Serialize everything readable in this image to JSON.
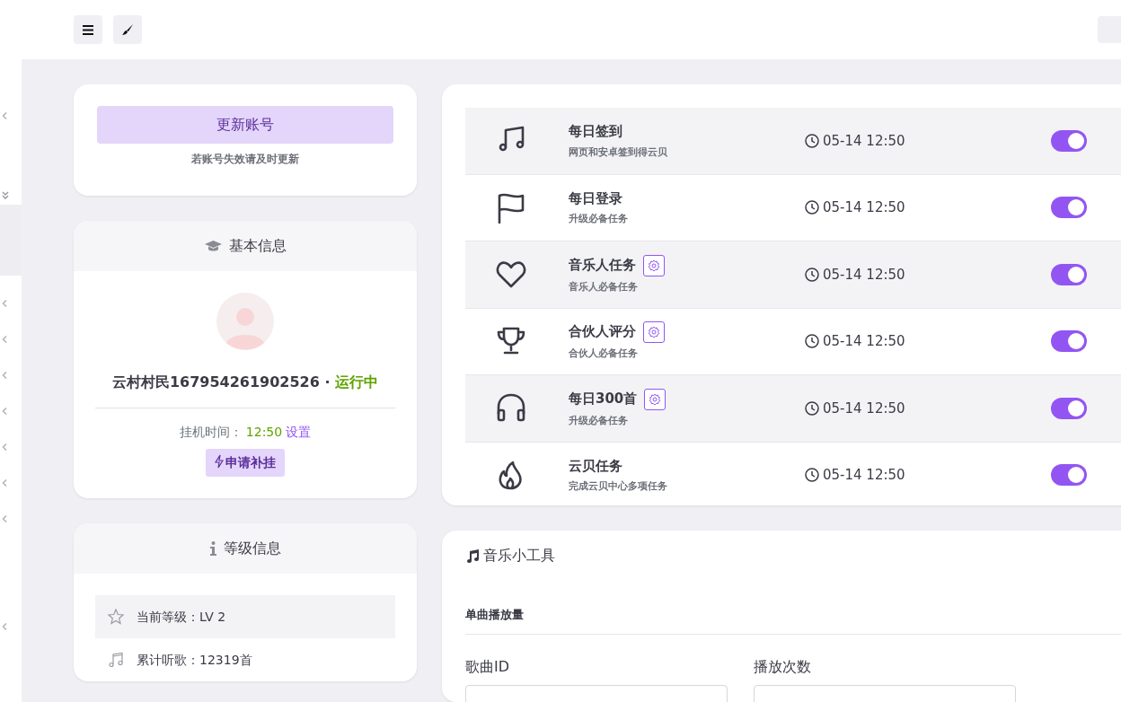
{
  "update_card": {
    "button": "更新账号",
    "hint": "若账号失效请及时更新"
  },
  "basic_info": {
    "title": "基本信息",
    "username": "云村村民167954261902526",
    "separator": "·",
    "status": "运行中",
    "time_label": "挂机时间：",
    "time_value": "12:50",
    "time_link": "设置",
    "apply_button": "申请补挂"
  },
  "level_info": {
    "title": "等级信息",
    "items": [
      {
        "kind": "star",
        "text": "当前等级：LV 2"
      },
      {
        "kind": "music",
        "text": "累计听歌：12319首"
      }
    ]
  },
  "tasks": [
    {
      "kind": "music",
      "title": "每日签到",
      "desc": "网页和安卓签到得云贝",
      "settings": false,
      "time": "05-14 12:50",
      "on": true
    },
    {
      "kind": "flag",
      "title": "每日登录",
      "desc": "升级必备任务",
      "settings": false,
      "time": "05-14 12:50",
      "on": true
    },
    {
      "kind": "heart",
      "title": "音乐人任务",
      "desc": "音乐人必备任务",
      "settings": true,
      "time": "05-14 12:50",
      "on": true
    },
    {
      "kind": "trophy",
      "title": "合伙人评分",
      "desc": "合伙人必备任务",
      "settings": true,
      "time": "05-14 12:50",
      "on": true
    },
    {
      "kind": "headphones",
      "title": "每日300首",
      "desc": "升级必备任务",
      "settings": true,
      "time": "05-14 12:50",
      "on": true
    },
    {
      "kind": "fire",
      "title": "云贝任务",
      "desc": "完成云贝中心多项任务",
      "settings": false,
      "time": "05-14 12:50",
      "on": true
    }
  ],
  "tools": {
    "title": "音乐小工具",
    "section": "单曲播放量",
    "fields": [
      {
        "label": "歌曲ID"
      },
      {
        "label": "播放次数"
      }
    ]
  }
}
